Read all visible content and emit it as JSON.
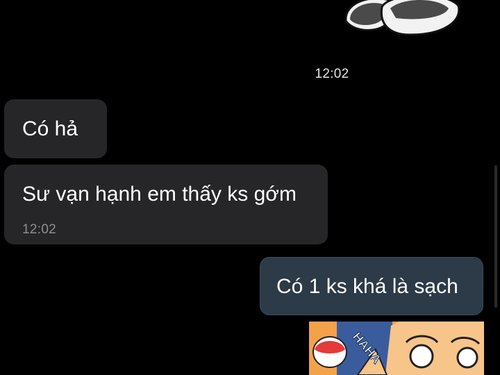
{
  "chat": {
    "date_time": "12:02",
    "messages": [
      {
        "direction": "incoming",
        "text": "Có hả"
      },
      {
        "direction": "incoming",
        "text": "Sư vạn hạnh em thấy ks gớm",
        "time": "12:02"
      },
      {
        "direction": "outgoing",
        "text": "Có 1 ks khá là sạch"
      }
    ],
    "sticker_bottom_text": "HAHA"
  },
  "colors": {
    "background": "#000000",
    "incoming_bubble": "#262629",
    "outgoing_bubble": "#2d3a47",
    "timestamp_text": "#8e8e93"
  }
}
